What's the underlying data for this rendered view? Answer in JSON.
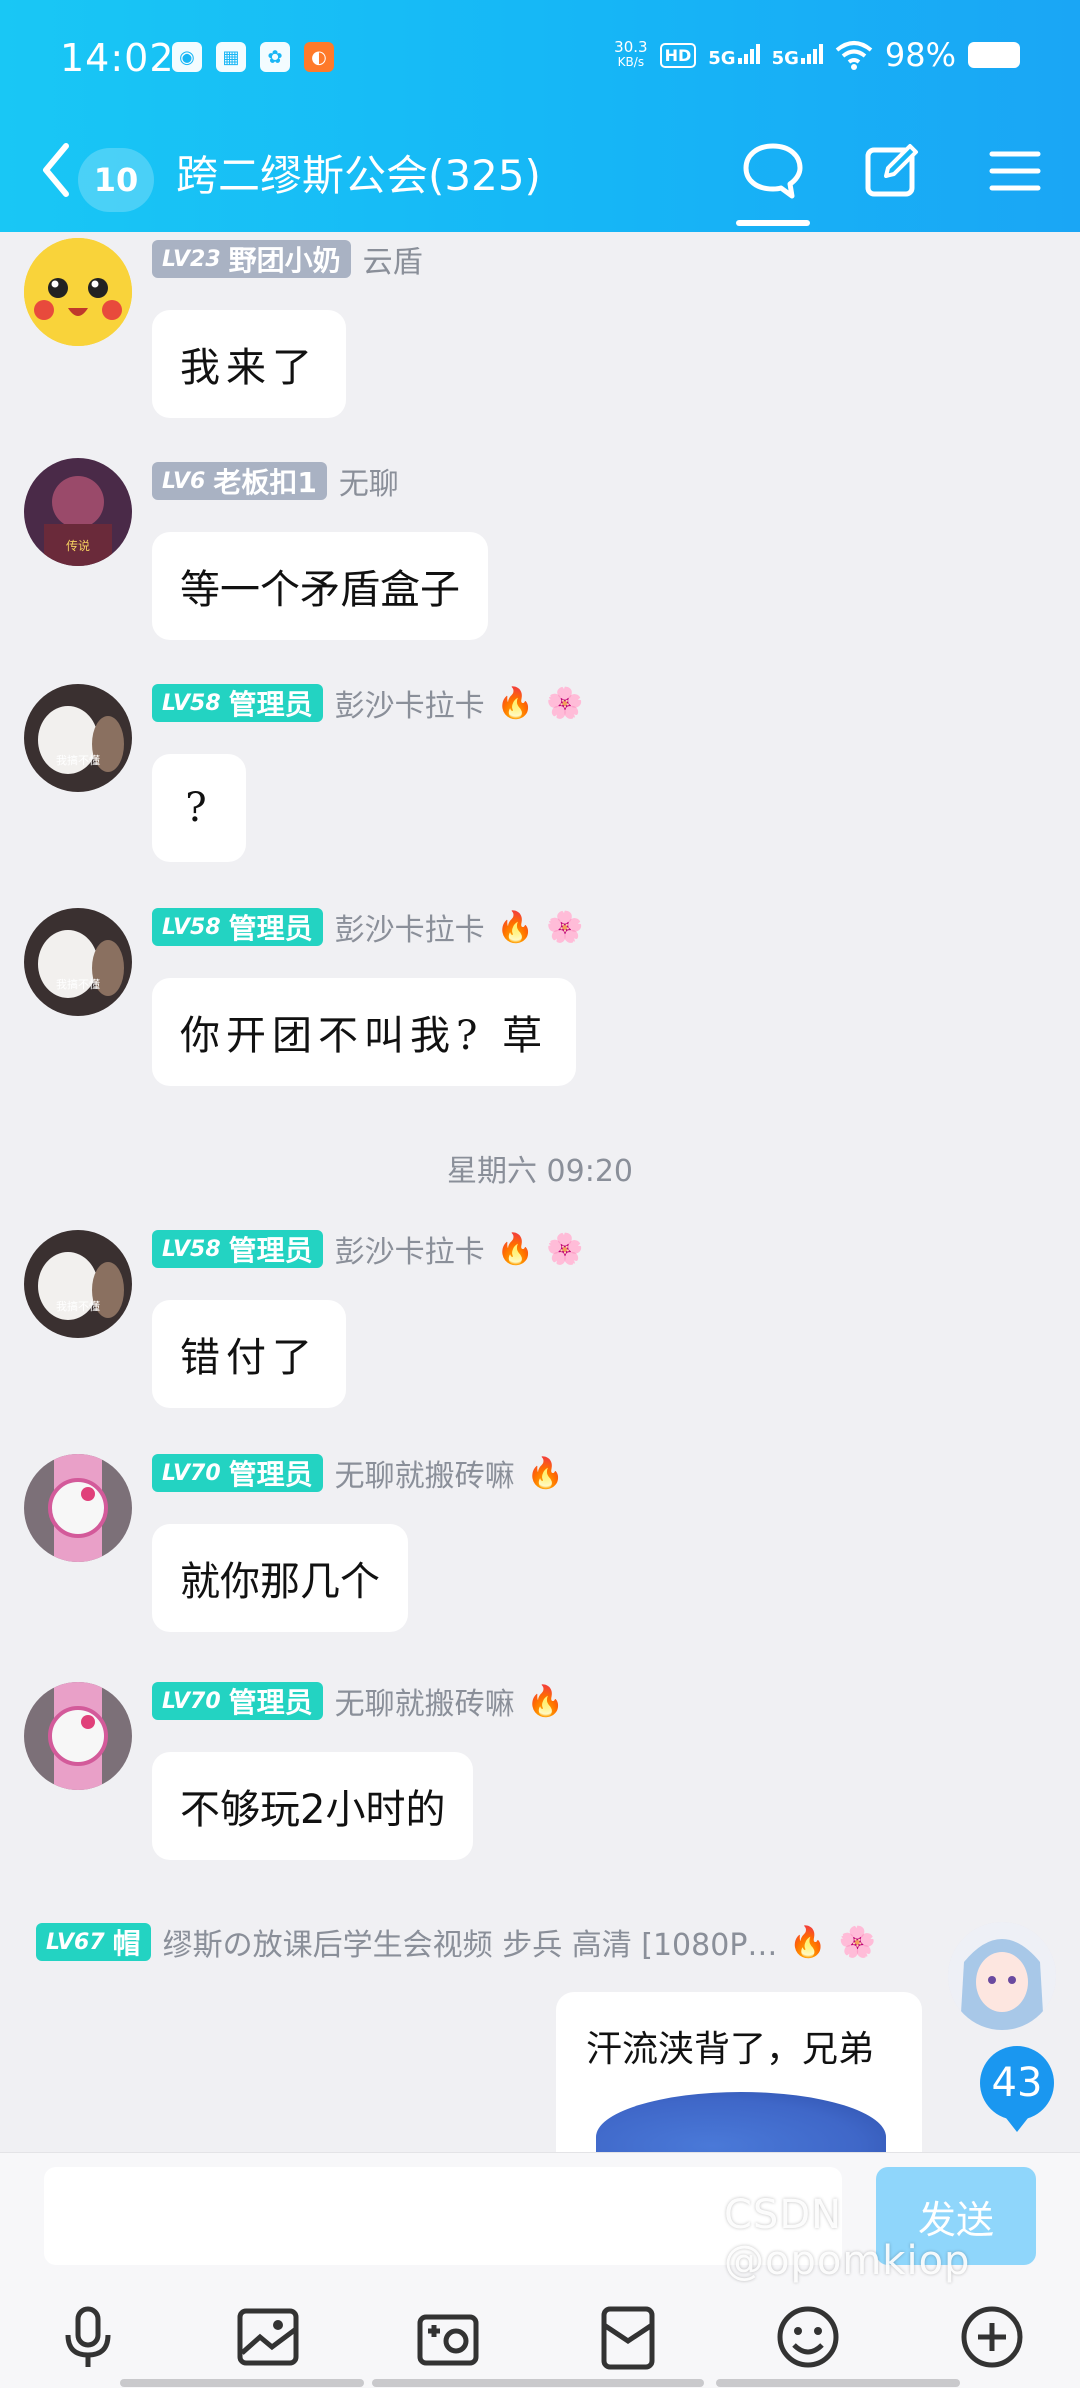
{
  "status_bar": {
    "time": "14:02",
    "net_speed_value": "30.3",
    "net_speed_unit": "KB/s",
    "hd_label": "HD",
    "signal1": "5G",
    "signal2": "5G",
    "battery": "98%"
  },
  "header": {
    "unread_count": "10",
    "title": "跨二缪斯公会(325)",
    "icons": [
      "chat-bubble-icon",
      "edit-icon",
      "menu-icon"
    ]
  },
  "messages": [
    {
      "level": "LV23",
      "badge": "野团小奶",
      "badge_color": "#a9b2c3",
      "sender": "云盾",
      "text": "我来了",
      "fire": false,
      "face": false
    },
    {
      "level": "LV6",
      "badge": "老板扣1",
      "badge_color": "#a9b2c3",
      "sender": "无聊",
      "text": "等一个矛盾盒子",
      "fire": false,
      "face": false
    },
    {
      "level": "LV58",
      "badge": "管理员",
      "badge_color": "#23d3c2",
      "sender": "彭沙卡拉卡",
      "text": "?",
      "fire": true,
      "face": true
    },
    {
      "level": "LV58",
      "badge": "管理员",
      "badge_color": "#23d3c2",
      "sender": "彭沙卡拉卡",
      "text": "你开团不叫我? 草",
      "fire": true,
      "face": true
    },
    {
      "level": "LV58",
      "badge": "管理员",
      "badge_color": "#23d3c2",
      "sender": "彭沙卡拉卡",
      "text": "错付了",
      "fire": true,
      "face": true
    },
    {
      "level": "LV70",
      "badge": "管理员",
      "badge_color": "#23d3c2",
      "sender": "无聊就搬砖嘛",
      "text": "就你那几个",
      "fire": true,
      "face": false
    },
    {
      "level": "LV70",
      "badge": "管理员",
      "badge_color": "#23d3c2",
      "sender": "无聊就搬砖嘛",
      "text": "不够玩2小时的",
      "fire": true,
      "face": false
    }
  ],
  "time_separator": "星期六 09:20",
  "own_message": {
    "level": "LV67",
    "badge": "帽",
    "sender": "缪斯の放课后学生会视频 步兵 高清 [1080P…",
    "text": "汗流浃背了，兄弟"
  },
  "avatar_text": {
    "legend": "传说",
    "cat": "我搞不懂"
  },
  "floating_badge": "43",
  "input": {
    "placeholder": "",
    "send_label": "发送"
  },
  "toolbar_icons": [
    "microphone-icon",
    "image-icon",
    "camera-icon",
    "red-packet-icon",
    "emoji-icon",
    "plus-icon"
  ],
  "watermark": "CSDN @opomkiop",
  "colors": {
    "header": "#16b6f6",
    "send_button": "#8fd6fb",
    "teal_badge": "#23d3c2",
    "gray_badge": "#a9b2c3",
    "badge_blue": "#1a97f0"
  }
}
